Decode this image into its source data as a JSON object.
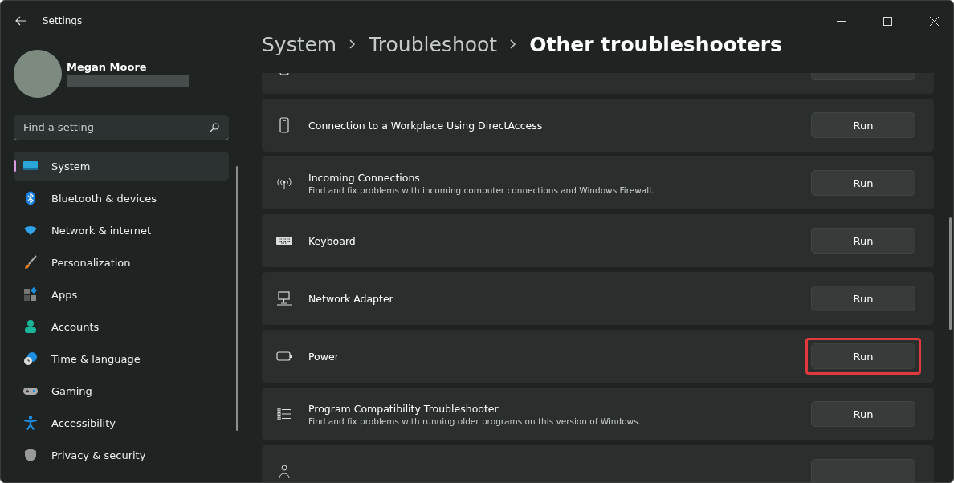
{
  "window": {
    "title": "Settings"
  },
  "user": {
    "name": "Megan Moore"
  },
  "search": {
    "placeholder": "Find a setting"
  },
  "sidebar": {
    "items": [
      {
        "label": "System",
        "selected": true
      },
      {
        "label": "Bluetooth & devices",
        "selected": false
      },
      {
        "label": "Network & internet",
        "selected": false
      },
      {
        "label": "Personalization",
        "selected": false
      },
      {
        "label": "Apps",
        "selected": false
      },
      {
        "label": "Accounts",
        "selected": false
      },
      {
        "label": "Time & language",
        "selected": false
      },
      {
        "label": "Gaming",
        "selected": false
      },
      {
        "label": "Accessibility",
        "selected": false
      },
      {
        "label": "Privacy & security",
        "selected": false
      }
    ]
  },
  "breadcrumb": [
    "System",
    "Troubleshoot",
    "Other troubleshooters"
  ],
  "troubleshooters": [
    {
      "kind": "partial",
      "highlighted": false
    },
    {
      "kind": "full",
      "title": "Connection to a Workplace Using DirectAccess",
      "button": "Run",
      "highlighted": false
    },
    {
      "kind": "full",
      "title": "Incoming Connections",
      "description": "Find and fix problems with incoming computer connections and Windows Firewall.",
      "button": "Run",
      "highlighted": false
    },
    {
      "kind": "full",
      "title": "Keyboard",
      "button": "Run",
      "highlighted": false
    },
    {
      "kind": "full",
      "title": "Network Adapter",
      "button": "Run",
      "highlighted": false
    },
    {
      "kind": "full",
      "title": "Power",
      "button": "Run",
      "highlighted": true
    },
    {
      "kind": "full",
      "title": "Program Compatibility Troubleshooter",
      "description": "Find and fix problems with running older programs on this version of Windows.",
      "button": "Run",
      "highlighted": false
    },
    {
      "kind": "partial",
      "highlighted": false
    }
  ]
}
